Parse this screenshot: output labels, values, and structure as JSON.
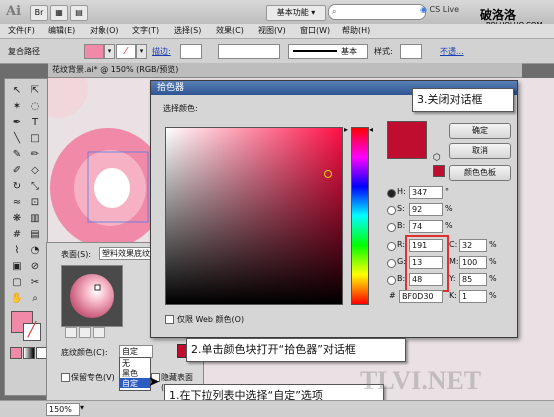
{
  "app": {
    "logo": "Ai",
    "workspace": "基本功能",
    "search_placeholder": "",
    "cslive": "CS Live",
    "watermark_top": "破洛洛",
    "watermark_url": "POLUOLUO.COM",
    "watermark_center": "TLVI.NET"
  },
  "menu": [
    "文件(F)",
    "编辑(E)",
    "对象(O)",
    "文字(T)",
    "选择(S)",
    "效果(C)",
    "视图(V)",
    "窗口(W)",
    "帮助(H)"
  ],
  "control": {
    "selection": "复合路径",
    "stroke_label": "描边:",
    "stroke_style": "基本",
    "style_label": "样式:",
    "opacity": "不透..."
  },
  "document": {
    "tab": "花纹背景.ai* @ 150% (RGB/预览)",
    "zoom": "150%"
  },
  "texture_panel": {
    "surface_label": "表面(S):",
    "surface_value": "塑料效果底纹",
    "base_color_label": "底纹颜色(C):",
    "base_color_value": "自定",
    "options": [
      "无",
      "黑色",
      "自定"
    ],
    "keep_spot_label": "保留专色(V)",
    "hidden_surface_label": "隐藏表面(W)"
  },
  "color_picker": {
    "title": "拾色器",
    "select_label": "选择颜色:",
    "web_only_label": "仅限 Web 颜色(O)",
    "buttons": {
      "ok": "确定",
      "cancel": "取消",
      "swatches": "颜色色板"
    },
    "H": "347",
    "S": "92",
    "B": "74",
    "R": "191",
    "G": "13",
    "Bv": "48",
    "C": "32",
    "M": "100",
    "Y": "85",
    "K": "1",
    "hex": "BF0D30",
    "labels": {
      "H": "H:",
      "S": "S:",
      "B": "B:",
      "R": "R:",
      "G": "G:",
      "Bb": "B:",
      "C": "C:",
      "M": "M:",
      "Y": "Y:",
      "K": "K:",
      "hash": "#"
    },
    "deg": "°",
    "pct": "%",
    "color_new": "#bf0d30",
    "color_old": "#bf0d30"
  },
  "callouts": {
    "step1": "1.在下拉列表中选择“自定”选项",
    "step2": "2.单击颜色块打开“拾色器”对话框",
    "step3": "3.关闭对话框"
  },
  "colors": {
    "accent_red": "#bf0d30",
    "pink_fill": "#f08aa8",
    "highlight_box": "#e03030"
  }
}
